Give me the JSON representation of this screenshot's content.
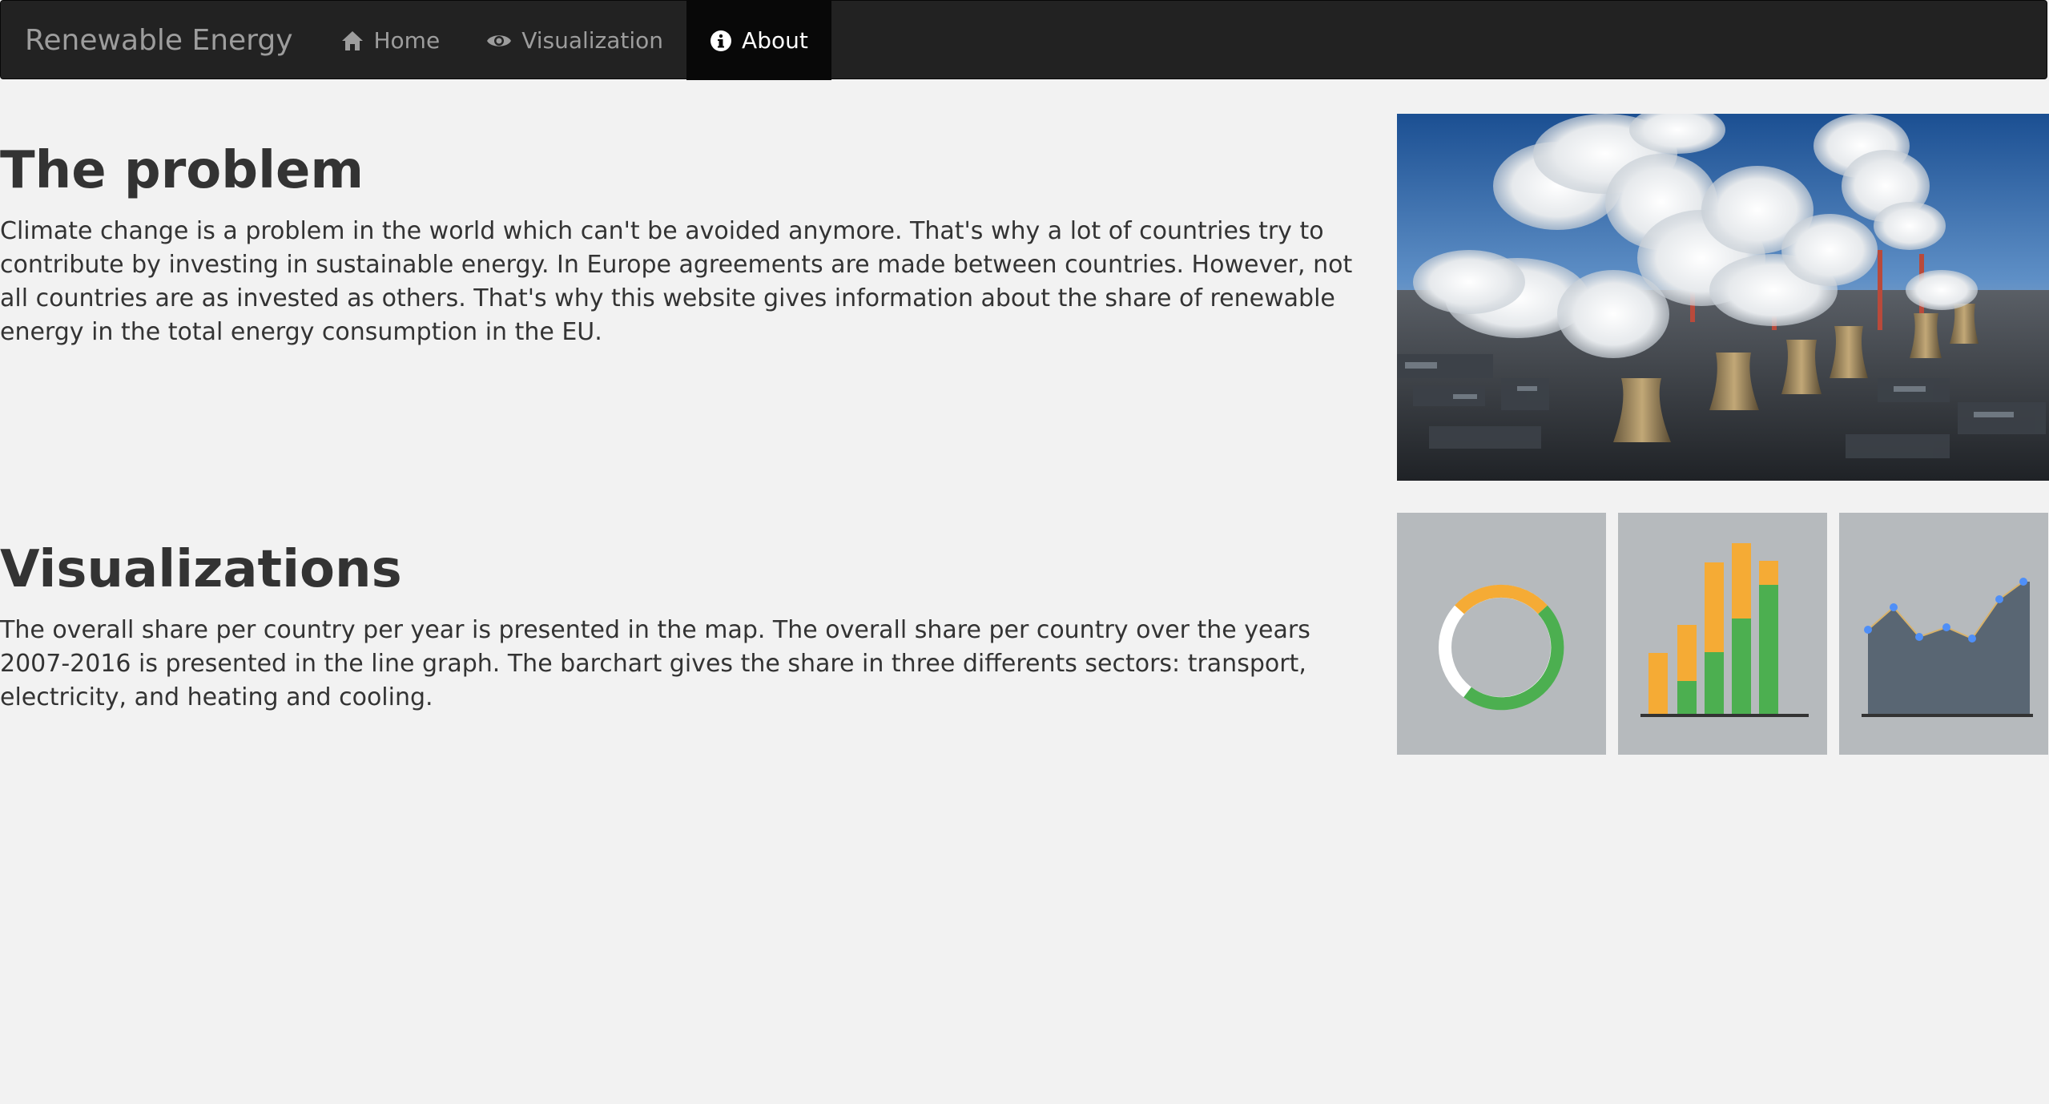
{
  "navbar": {
    "brand": "Renewable Energy",
    "items": [
      {
        "label": "Home",
        "icon": "home-icon"
      },
      {
        "label": "Visualization",
        "icon": "eye-icon"
      },
      {
        "label": "About",
        "icon": "info-icon",
        "active": true
      }
    ]
  },
  "problem": {
    "title": "The problem",
    "text": "Climate change is a problem in the world which can't be avoided anymore. That's why a lot of countries try to contribute by investing in sustainable energy. In Europe agreements are made between countries. However, not all countries are as invested as others. That's why this website gives information about the share of renewable energy in the total energy consumption in the EU."
  },
  "visualizations": {
    "title": "Visualizations",
    "text": "The overall share per country per year is presented in the map. The overall share per country over the years 2007-2016 is presented in the line graph. The barchart gives the share in three differents sectors: transport, electricity, and heating and cooling."
  },
  "images": {
    "hero": "power-plant-smokestacks-photo",
    "thumbnails": [
      "donut-chart-icon",
      "stacked-bar-chart-icon",
      "area-chart-icon"
    ]
  },
  "colors": {
    "navbar_bg": "#222222",
    "navbar_active_bg": "#080808",
    "navbar_text": "#9d9d9d",
    "page_bg": "#f2f2f2",
    "thumb_bg": "#b6babd",
    "accent_orange": "#f5ab35",
    "accent_green": "#4caf50",
    "area_fill": "#596673",
    "point_blue": "#4f8ff7"
  }
}
